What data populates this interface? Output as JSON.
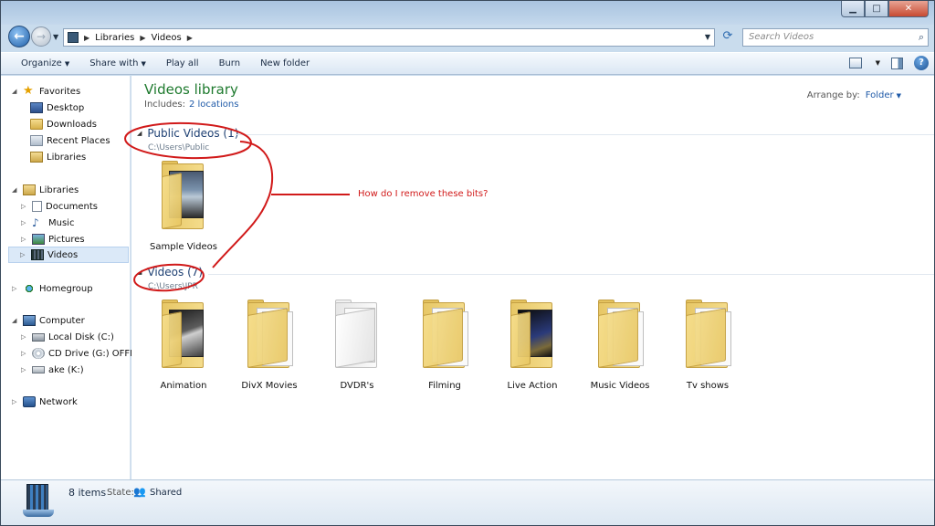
{
  "window": {
    "caption_buttons": {
      "minimize": "▁",
      "maximize": "□",
      "close": "✕"
    }
  },
  "nav": {
    "back_label": "←",
    "forward_label": "→",
    "breadcrumb": [
      "Libraries",
      "Videos"
    ],
    "search_placeholder": "Search Videos"
  },
  "commandbar": {
    "items": [
      "Organize",
      "Share with",
      "Play all",
      "Burn",
      "New folder"
    ]
  },
  "navpane": {
    "favorites": {
      "label": "Favorites",
      "items": [
        "Desktop",
        "Downloads",
        "Recent Places",
        "Libraries"
      ]
    },
    "libraries": {
      "label": "Libraries",
      "items": [
        "Documents",
        "Music",
        "Pictures",
        "Videos"
      ]
    },
    "homegroup": "Homegroup",
    "computer": {
      "label": "Computer",
      "items": [
        "Local Disk (C:)",
        "CD Drive (G:) OFFICE",
        "ake (K:)"
      ]
    },
    "network": "Network"
  },
  "content": {
    "title": "Videos library",
    "includes_label": "Includes:",
    "includes_link": "2 locations",
    "arrange_label": "Arrange by:",
    "arrange_value": "Folder",
    "groups": [
      {
        "title": "Public Videos (1)",
        "path": "C:\\Users\\Public",
        "items": [
          "Sample Videos"
        ]
      },
      {
        "title": "Videos (7)",
        "path": "C:\\Users\\JPR",
        "items": [
          "Animation",
          "DivX Movies",
          "DVDR's",
          "Filming",
          "Live Action",
          "Music Videos",
          "Tv shows"
        ]
      }
    ]
  },
  "annotation": {
    "text": "How do I remove these bits?",
    "color": "#d11a1a"
  },
  "status": {
    "count": "8 items",
    "state_label": "State:",
    "state_value": "Shared"
  },
  "colors": {
    "title_green": "#1e7a2e",
    "link_blue": "#1f5aa8",
    "group_blue": "#1d3f72"
  }
}
